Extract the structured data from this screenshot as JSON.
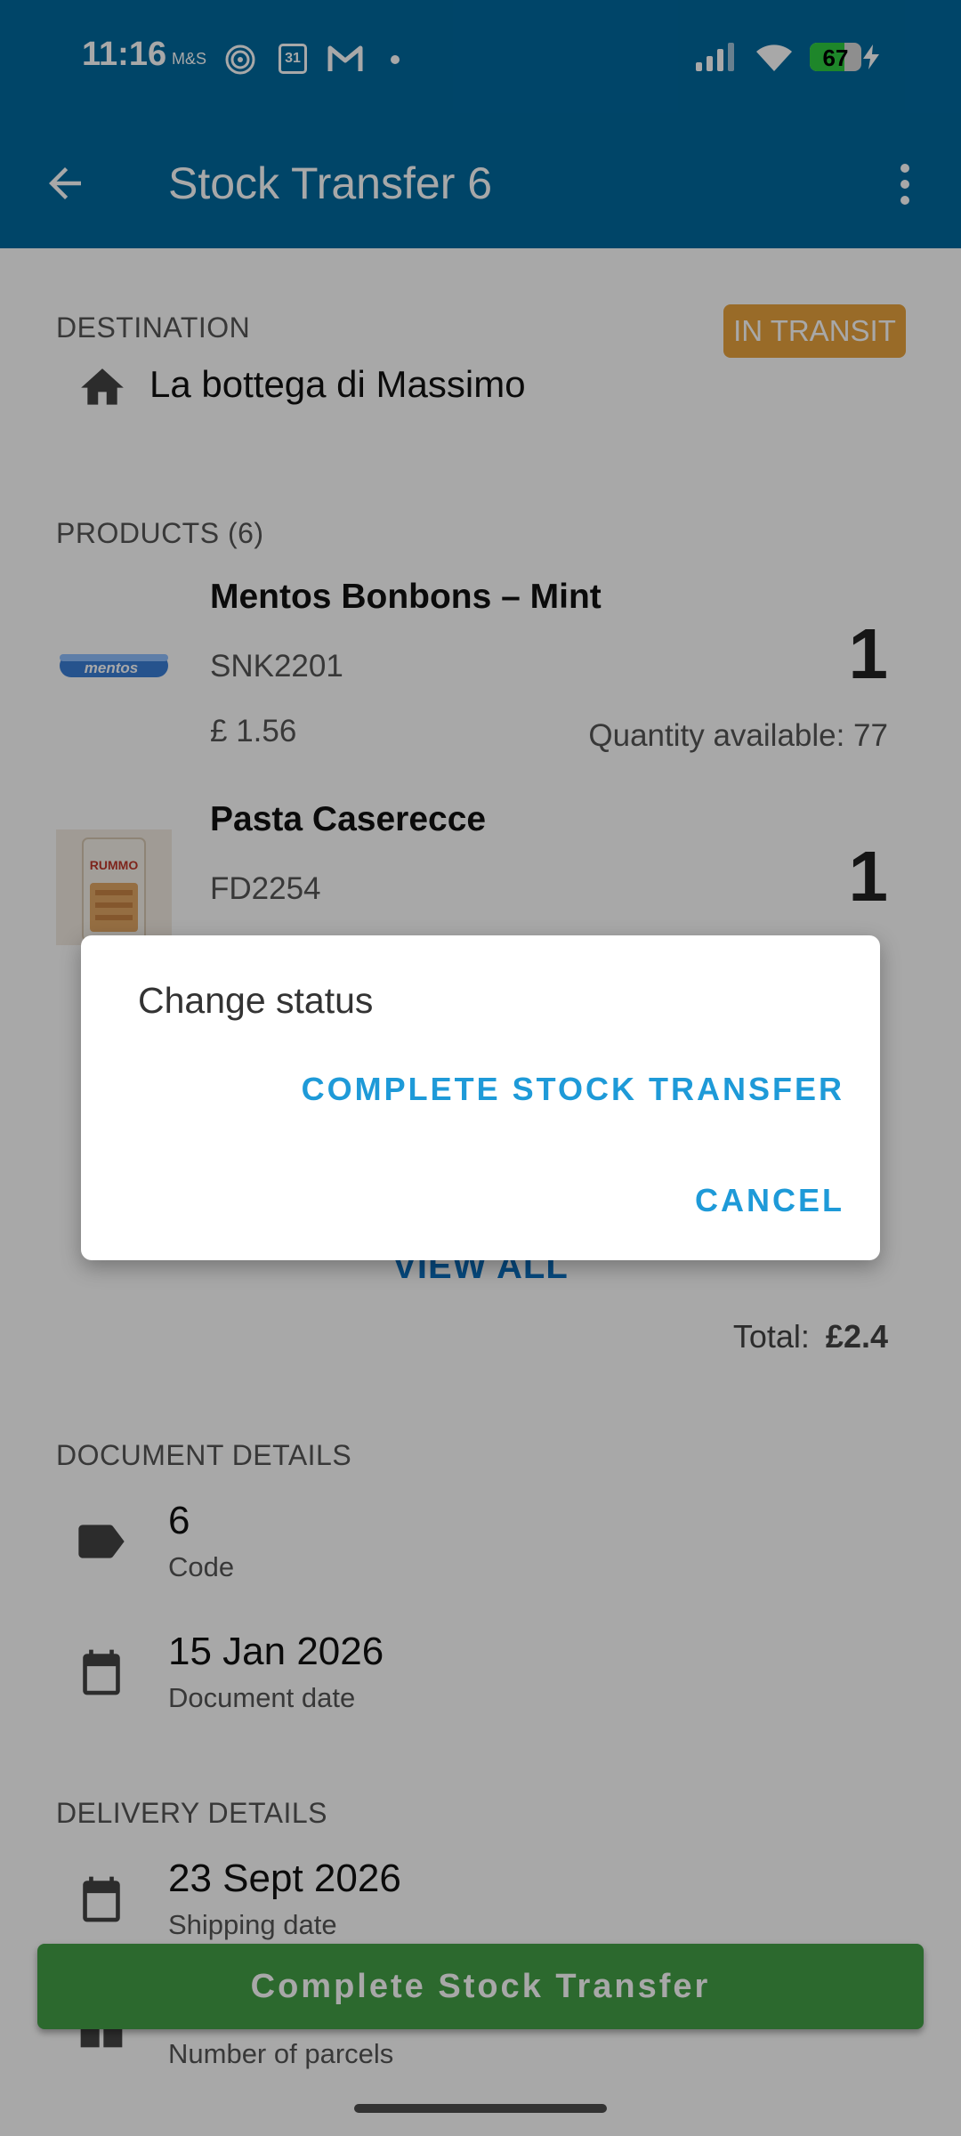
{
  "status_bar": {
    "time": "11:16",
    "carrier": "M&S",
    "calendar_day": "31",
    "battery": "67",
    "battery_level": 0.67
  },
  "app_bar": {
    "title": "Stock Transfer 6"
  },
  "destination": {
    "label": "DESTINATION",
    "name": "La bottega di Massimo",
    "status_badge": "IN TRANSIT"
  },
  "products": {
    "label": "PRODUCTS (6)",
    "items": [
      {
        "name": "Mentos Bonbons – Mint",
        "sku": "SNK2201",
        "price": "£ 1.56",
        "quantity": "1",
        "available": "Quantity available: 77",
        "image_text": "mentos"
      },
      {
        "name": "Pasta Caserecce",
        "sku": "FD2254",
        "quantity": "1",
        "image_text": "RUMMO"
      }
    ],
    "view_all": "VIEW ALL",
    "total_label": "Total:",
    "total_value": "£2.4"
  },
  "document_details": {
    "label": "DOCUMENT DETAILS",
    "code_value": "6",
    "code_label": "Code",
    "date_value": "15 Jan 2026",
    "date_label": "Document date"
  },
  "delivery_details": {
    "label": "DELIVERY DETAILS",
    "shipping_value": "23 Sept 2026",
    "shipping_label": "Shipping date",
    "parcels_label": "Number of parcels"
  },
  "bottom_button": "Complete Stock Transfer",
  "dialog": {
    "title": "Change status",
    "primary_action": "COMPLETE STOCK TRANSFER",
    "cancel_action": "CANCEL"
  },
  "colors": {
    "app_bar": "#00699f",
    "badge": "#e8a33d",
    "accent": "#1e9ad8",
    "button_green": "#43a047"
  }
}
